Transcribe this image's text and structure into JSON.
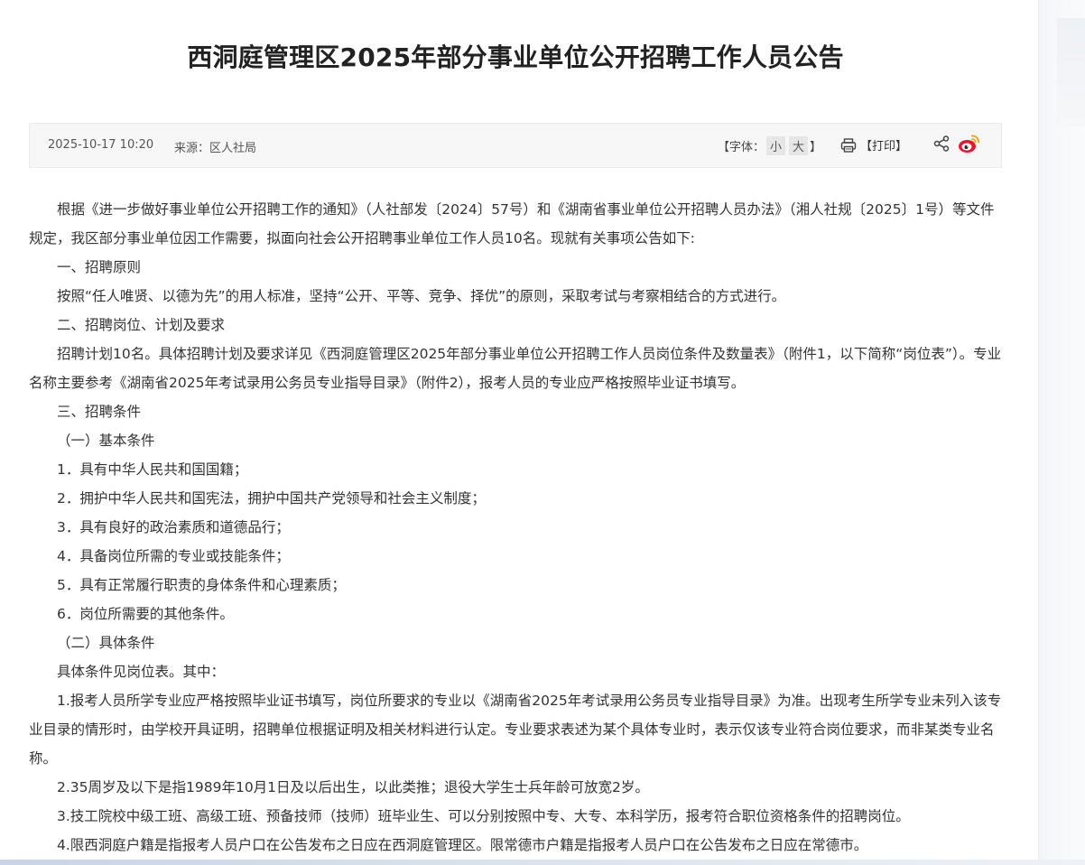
{
  "article": {
    "title": "西洞庭管理区2025年部分事业单位公开招聘工作人员公告",
    "meta": {
      "date": "2025-10-17 10:20",
      "source": "来源：区人社局",
      "font_label_prefix": "【字体：",
      "font_small": "小",
      "font_large": "大",
      "font_label_suffix": "】",
      "print_label": "【打印】"
    },
    "paragraphs": [
      "根据《进一步做好事业单位公开招聘工作的通知》（人社部发〔2024〕57号）和《湖南省事业单位公开招聘人员办法》（湘人社规〔2025〕1号）等文件规定，我区部分事业单位因工作需要，拟面向社会公开招聘事业单位工作人员10名。现就有关事项公告如下:",
      "一、招聘原则",
      "按照“任人唯贤、以德为先”的用人标准，坚持“公开、平等、竞争、择优”的原则，采取考试与考察相结合的方式进行。",
      "二、招聘岗位、计划及要求",
      "招聘计划10名。具体招聘计划及要求详见《西洞庭管理区2025年部分事业单位公开招聘工作人员岗位条件及数量表》（附件1，以下简称“岗位表”）。专业名称主要参考《湖南省2025年考试录用公务员专业指导目录》（附件2），报考人员的专业应严格按照毕业证书填写。",
      "三、招聘条件",
      "（一）基本条件",
      "1．具有中华人民共和国国籍；",
      "2．拥护中华人民共和国宪法，拥护中国共产党领导和社会主义制度；",
      "3．具有良好的政治素质和道德品行；",
      "4．具备岗位所需的专业或技能条件；",
      "5．具有正常履行职责的身体条件和心理素质；",
      "6．岗位所需要的其他条件。",
      "（二）具体条件",
      "具体条件见岗位表。其中：",
      "1.报考人员所学专业应严格按照毕业证书填写，岗位所要求的专业以《湖南省2025年考试录用公务员专业指导目录》为准。出现考生所学专业未列入该专业目录的情形时，由学校开具证明，招聘单位根据证明及相关材料进行认定。专业要求表述为某个具体专业时，表示仅该专业符合岗位要求，而非某类专业名称。",
      "2.35周岁及以下是指1989年10月1日及以后出生，以此类推；退役大学生士兵年龄可放宽2岁。",
      "3.技工院校中级工班、高级工班、预备技师（技师）班毕业生、可以分别按照中专、大专、本科学历，报考符合职位资格条件的招聘岗位。",
      " 4.限西洞庭户籍是指报考人员户口在公告发布之日应在西洞庭管理区。限常德市户籍是指报考人员户口在公告发布之日应在常德市。"
    ]
  },
  "icons": {
    "print": "printer-icon",
    "share": "share-icon",
    "weibo": "weibo-icon"
  },
  "colors": {
    "title": "#222222",
    "body_text": "#333333",
    "meta_bar_bg": "#f7f7f7",
    "weibo_red": "#e6162d",
    "weibo_orange": "#f5a623"
  }
}
